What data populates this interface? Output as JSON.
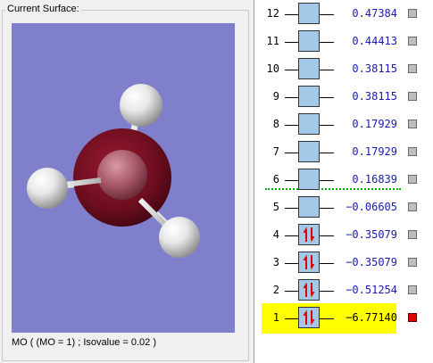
{
  "panel": {
    "group_title": "Current Surface:",
    "caption": "MO ( (MO = 1) ; Isovalue = 0.02 )",
    "viewport_bg": "#7f7fcb"
  },
  "orbitals": [
    {
      "num": "12",
      "energy": "0.47384",
      "occupied": false,
      "selected": false
    },
    {
      "num": "11",
      "energy": "0.44413",
      "occupied": false,
      "selected": false
    },
    {
      "num": "10",
      "energy": "0.38115",
      "occupied": false,
      "selected": false
    },
    {
      "num": "9",
      "energy": "0.38115",
      "occupied": false,
      "selected": false
    },
    {
      "num": "8",
      "energy": "0.17929",
      "occupied": false,
      "selected": false
    },
    {
      "num": "7",
      "energy": "0.17929",
      "occupied": false,
      "selected": false
    },
    {
      "num": "6",
      "energy": "0.16839",
      "occupied": false,
      "selected": false
    },
    {
      "num": "5",
      "energy": "-0.06605",
      "occupied": false,
      "selected": false
    },
    {
      "num": "4",
      "energy": "-0.35079",
      "occupied": true,
      "selected": false
    },
    {
      "num": "3",
      "energy": "-0.35079",
      "occupied": true,
      "selected": false
    },
    {
      "num": "2",
      "energy": "-0.51254",
      "occupied": true,
      "selected": false
    },
    {
      "num": "1",
      "energy": "-6.77140",
      "occupied": true,
      "selected": true
    }
  ],
  "colors": {
    "highlight": "#ffff00",
    "box": "#a4c8e8",
    "energy_text": "#1a1ab0",
    "separator": "#00b000",
    "selected_check": "#e00000",
    "unselected_check": "#bdbdbd",
    "spin_arrow": "#e00000"
  },
  "icons": {
    "spin_pair": "up-down-arrows-icon",
    "checkbox": "visibility-checkbox-icon"
  }
}
